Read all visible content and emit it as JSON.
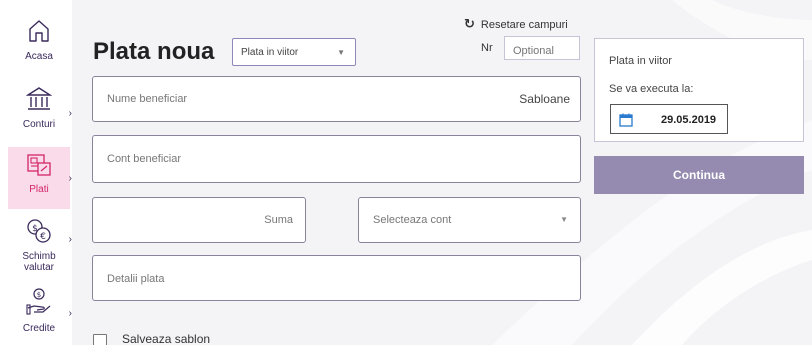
{
  "nav": [
    {
      "label": "Acasa",
      "icon": "home-icon",
      "active": false
    },
    {
      "label": "Conturi",
      "icon": "bank-icon",
      "active": false
    },
    {
      "label": "Plati",
      "icon": "payments-icon",
      "active": true
    },
    {
      "label": "Schimb valutar",
      "icon": "currency-exchange-icon",
      "active": false
    },
    {
      "label": "Credite",
      "icon": "loan-hand-icon",
      "active": false
    }
  ],
  "header": {
    "title": "Plata noua",
    "payment_type": "Plata in viitor",
    "reset_label": "Resetare campuri",
    "nr_label": "Nr",
    "nr_placeholder": "Optional"
  },
  "form": {
    "beneficiary_placeholder": "Nume beneficiar",
    "templates_label": "Sabloane",
    "account_placeholder": "Cont beneficiar",
    "amount_placeholder": "Suma",
    "select_account_placeholder": "Selecteaza cont",
    "details_placeholder": "Detalii plata",
    "save_template_label": "Salveaza sablon"
  },
  "schedule": {
    "title": "Plata in viitor",
    "execute_label": "Se va executa la:",
    "date": "29.05.2019"
  },
  "continue_label": "Continua",
  "colors": {
    "active_nav_bg": "#f9dbe9",
    "active_nav_text": "#d4246b",
    "nav_text": "#3a2a5c",
    "continue_button": "#958bb0",
    "main_bg": "#f4f3f6"
  }
}
